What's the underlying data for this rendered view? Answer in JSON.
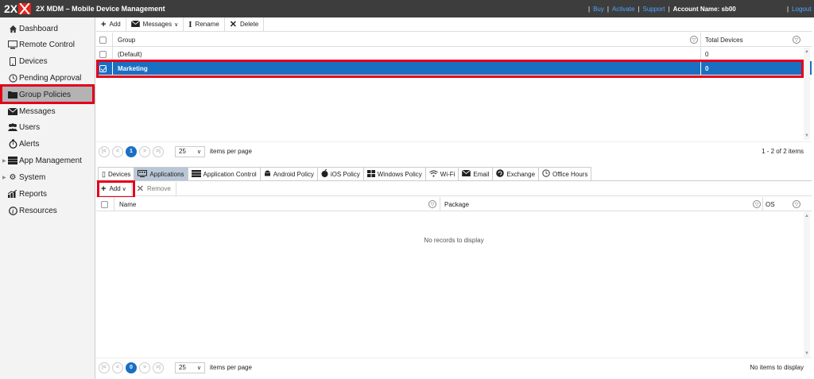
{
  "app": {
    "logo_text": "2X",
    "title": "2X MDM – Mobile Device Management"
  },
  "top_links": {
    "buy": "Buy",
    "activate": "Activate",
    "support": "Support",
    "sep": "|",
    "account": "Account Name: sb00",
    "logout": "Logout"
  },
  "sidebar": {
    "items": [
      {
        "label": "Dashboard",
        "icon": "home-icon"
      },
      {
        "label": "Remote Control",
        "icon": "monitor-icon"
      },
      {
        "label": "Devices",
        "icon": "phone-icon"
      },
      {
        "label": "Pending Approval",
        "icon": "clock-icon"
      },
      {
        "label": "Group Policies",
        "icon": "folder-icon",
        "active": true
      },
      {
        "label": "Messages",
        "icon": "envelope-icon"
      },
      {
        "label": "Users",
        "icon": "users-icon"
      },
      {
        "label": "Alerts",
        "icon": "stopwatch-icon"
      },
      {
        "label": "App Management",
        "icon": "apps-icon"
      },
      {
        "label": "System",
        "icon": "gears-icon"
      },
      {
        "label": "Reports",
        "icon": "chart-icon"
      },
      {
        "label": "Resources",
        "icon": "info-icon"
      }
    ]
  },
  "toolbar": {
    "add": "Add",
    "messages": "Messages",
    "rename": "Rename",
    "delete": "Delete"
  },
  "groups_grid": {
    "columns": [
      "Group",
      "Total Devices"
    ],
    "rows": [
      {
        "group": "(Default)",
        "total": "0",
        "selected": false
      },
      {
        "group": "Marketing",
        "total": "0",
        "selected": true
      }
    ]
  },
  "groups_pager": {
    "current_page": "1",
    "page_size": "25",
    "per_page_label": "items per page",
    "info": "1 - 2 of 2 items"
  },
  "tabs": [
    {
      "label": "Devices",
      "icon": "phone-icon"
    },
    {
      "label": "Applications",
      "icon": "applications-icon",
      "active": true
    },
    {
      "label": "Application Control",
      "icon": "app-control-icon"
    },
    {
      "label": "Android Policy",
      "icon": "android-icon"
    },
    {
      "label": "iOS Policy",
      "icon": "apple-icon"
    },
    {
      "label": "Windows Policy",
      "icon": "windows-icon"
    },
    {
      "label": "Wi-Fi",
      "icon": "wifi-icon"
    },
    {
      "label": "Email",
      "icon": "envelope-icon"
    },
    {
      "label": "Exchange",
      "icon": "exchange-icon"
    },
    {
      "label": "Office Hours",
      "icon": "clock-icon"
    }
  ],
  "apps_toolbar": {
    "add": "Add",
    "remove": "Remove"
  },
  "apps_grid": {
    "columns": [
      "Name",
      "Package",
      "OS"
    ],
    "empty": "No records to display"
  },
  "apps_pager": {
    "current_page": "0",
    "page_size": "25",
    "per_page_label": "items per page",
    "info": "No items to display"
  },
  "colors": {
    "accent": "#1a6fc3",
    "highlight": "#e3001b",
    "topbar": "#3d3d3d",
    "link": "#4ea6ff"
  }
}
